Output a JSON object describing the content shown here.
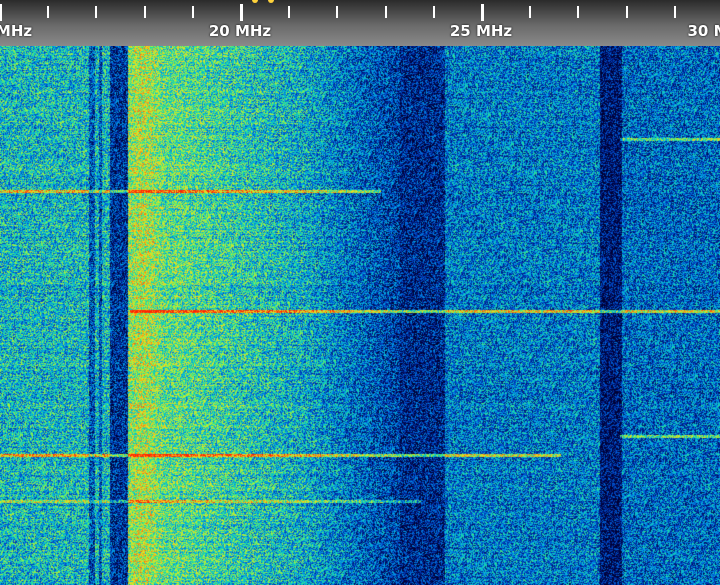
{
  "scale": {
    "labels": [
      {
        "text": "MHz"
      },
      {
        "text": "20 MHz"
      },
      {
        "text": "25 MHz"
      },
      {
        "text": "30 M"
      }
    ],
    "marker_color": "#ffd23a"
  },
  "waterfall": {
    "colormap": [
      "#000033",
      "#00208a",
      "#0050d0",
      "#00a8e8",
      "#20e0a0",
      "#a0f040",
      "#f0e020",
      "#ff8010",
      "#ff2000"
    ]
  }
}
